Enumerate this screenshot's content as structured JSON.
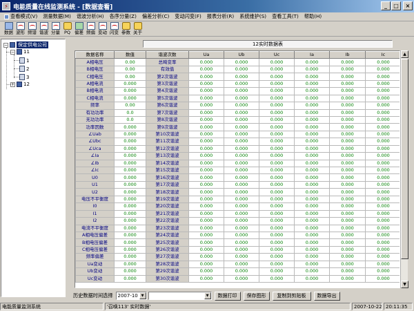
{
  "window": {
    "title": "电能质量在线监测系统 - [数据查看]"
  },
  "menu": [
    {
      "label": "查看模式(V)"
    },
    {
      "label": "测量数据(M)"
    },
    {
      "label": "谐波分析(H)"
    },
    {
      "label": "各序分量(Z)"
    },
    {
      "label": "偏差分析(C)"
    },
    {
      "label": "变动闪变(F)"
    },
    {
      "label": "报表分析(R)"
    },
    {
      "label": "系统维护(S)"
    },
    {
      "label": "查看工具(T)"
    },
    {
      "label": "帮助(H)"
    }
  ],
  "toolbar": [
    {
      "label": "数据",
      "icon": "data-icon"
    },
    {
      "label": "波形",
      "icon": "waveform-icon"
    },
    {
      "label": "频谱",
      "icon": "spectrum-icon"
    },
    {
      "label": "谐波",
      "icon": "harmonic-icon"
    },
    {
      "label": "分量",
      "icon": "component-icon"
    },
    {
      "label": "PQ",
      "icon": "pq-icon"
    },
    {
      "label": "偏差",
      "icon": "deviation-icon"
    },
    {
      "label": "频偏",
      "icon": "freq-deviation-icon"
    },
    {
      "label": "变动",
      "icon": "fluctuation-icon"
    },
    {
      "label": "闪变",
      "icon": "flicker-icon"
    },
    {
      "label": "参数",
      "icon": "parameter-icon"
    },
    {
      "label": "关于",
      "icon": "about-icon"
    }
  ],
  "tree": {
    "root": "保定供电公司",
    "group1": "11",
    "devices": [
      "1",
      "2",
      "3"
    ],
    "group2": "12"
  },
  "table": {
    "title": "12实时数据表",
    "headers": [
      "数据名称",
      "数值",
      "谐波次数",
      "Ua",
      "Ub",
      "Uc",
      "Ia",
      "Ib",
      "Ic"
    ],
    "names": [
      "A相电压",
      "B相电压",
      "C相电压",
      "A相电流",
      "B相电流",
      "C相电流",
      "频率",
      "有功功率",
      "无功功率",
      "功率因数",
      "∠Uab",
      "∠Ubc",
      "∠Uca",
      "∠Ia",
      "∠Ib",
      "∠Ic",
      "U0",
      "U1",
      "U2",
      "电压不平衡度",
      "I0",
      "I1",
      "I2",
      "电流不平衡度",
      "A相电压偏差",
      "B相电压偏差",
      "C相电压偏差",
      "频率偏差",
      "Ua变动",
      "Ub变动",
      "Uc变动"
    ],
    "values": [
      "0.00",
      "0.00",
      "0.00",
      "0.000",
      "0.000",
      "0.000",
      "0.00",
      "0.0",
      "0.0",
      "0.000",
      "0.000",
      "0.000",
      "0.000",
      "0.000",
      "0.000",
      "0.000",
      "0.000",
      "0.000",
      "0.000",
      "0.000",
      "0.000",
      "0.000",
      "0.000",
      "0.000",
      "0.000",
      "0.000",
      "0.000",
      "0.000",
      "0.000",
      "0.000",
      "0.000"
    ],
    "harmonics": [
      "总畸变率",
      "有效值",
      "第2次谐波",
      "第3次谐波",
      "第4次谐波",
      "第5次谐波",
      "第6次谐波",
      "第7次谐波",
      "第8次谐波",
      "第9次谐波",
      "第10次谐波",
      "第11次谐波",
      "第12次谐波",
      "第13次谐波",
      "第14次谐波",
      "第15次谐波",
      "第16次谐波",
      "第17次谐波",
      "第18次谐波",
      "第19次谐波",
      "第20次谐波",
      "第21次谐波",
      "第22次谐波",
      "第23次谐波",
      "第24次谐波",
      "第25次谐波",
      "第26次谐波",
      "第27次谐波",
      "第28次谐波",
      "第29次谐波",
      "第30次谐波"
    ],
    "phase_value": "0.000"
  },
  "bottom": {
    "history_label": "历史数据时间选择",
    "date_value": "2007-10",
    "buttons": [
      "数据打印",
      "保存图形",
      "复制到剪贴板",
      "数据导出"
    ]
  },
  "status": {
    "app": "电能质量监测系统",
    "message": "'召唤113' 实时数据'",
    "date": "2007-10-22",
    "time": "20:11:35"
  }
}
